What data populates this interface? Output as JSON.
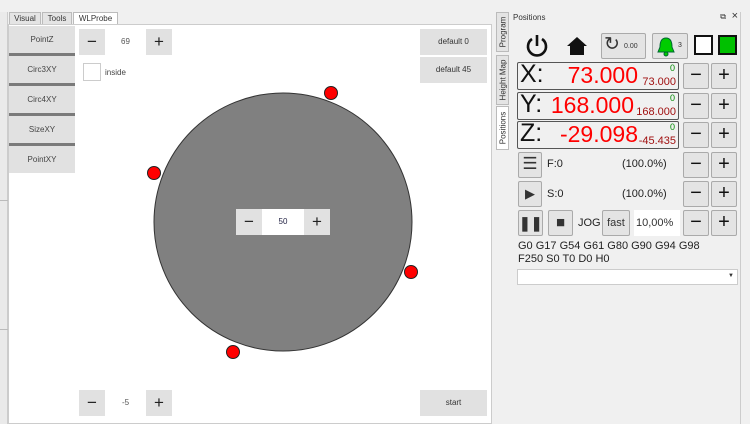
{
  "left_tabs": [
    "Visual",
    "Tools",
    "WLProbe"
  ],
  "probe_buttons": [
    "PointZ",
    "Circ3XY",
    "Circ4XY",
    "SizeXY",
    "PointXY"
  ],
  "top_stepper": {
    "value": "69",
    "minus": "−",
    "plus": "+"
  },
  "inside_label": "inside",
  "default_buttons": [
    "default 0",
    "default 45"
  ],
  "center_stepper": {
    "value": "50"
  },
  "bottom_stepper": {
    "value": "-5"
  },
  "start_label": "start",
  "right_tabs": [
    "Program",
    "Height Map",
    "Positions"
  ],
  "dock": {
    "title": "Positions",
    "float_icon": "⧉",
    "close_icon": "×"
  },
  "toolbar": {
    "spindle_value": "0.00",
    "bell_count": "3"
  },
  "axes": [
    {
      "label": "X:",
      "main": "73.000",
      "secondary": "73.000",
      "offset": "0"
    },
    {
      "label": "Y:",
      "main": "168.000",
      "secondary": "168.000",
      "offset": "0"
    },
    {
      "label": "Z:",
      "main": "-29.098",
      "secondary": "-45.435",
      "offset": "0"
    }
  ],
  "feed": {
    "label": "F:0",
    "percent": "(100.0%)"
  },
  "spindle": {
    "label": "S:0",
    "percent": "(100.0%)"
  },
  "jog": {
    "label": "JOG",
    "speed_button": "fast",
    "step": "10,00%"
  },
  "gcode_state": [
    "G0 G17 G54 G61 G80 G90 G94 G98",
    "F250 S0 T0 D0 H0"
  ],
  "colors": {
    "position": "#ff0000",
    "bell": "#00cc00",
    "indicator": "#00c000",
    "probe_point": "#ff0000",
    "workpiece": "#808080"
  }
}
